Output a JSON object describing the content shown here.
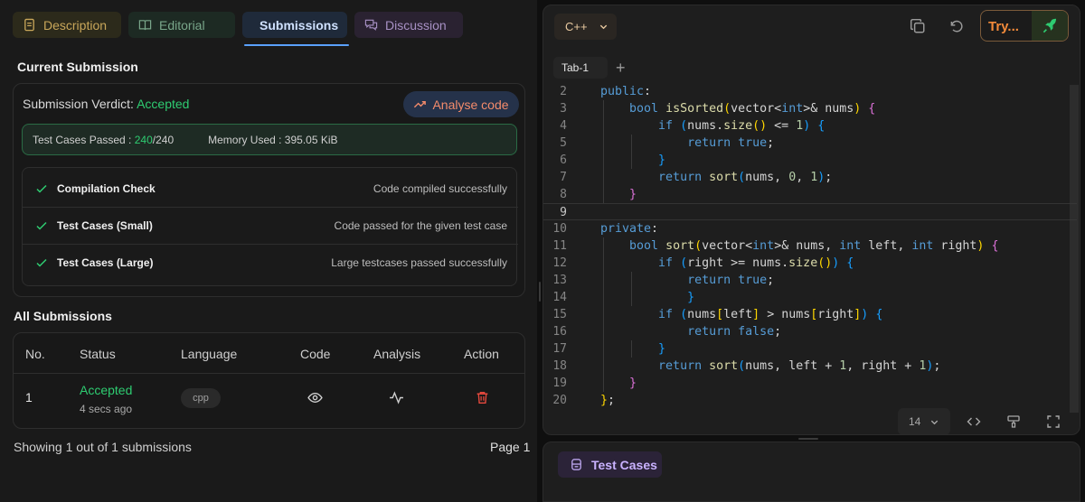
{
  "tabs": {
    "description": "Description",
    "editorial": "Editorial",
    "submissions": "Submissions",
    "discussion": "Discussion"
  },
  "current": {
    "heading": "Current Submission",
    "verdict_label": "Submission Verdict:",
    "verdict_value": "Accepted",
    "analyse_label": "Analyse code",
    "tests_label": "Test Cases Passed :",
    "tests_passed": "240",
    "tests_total": "/240",
    "memory_label": "Memory Used : 395.05 KiB",
    "checks": [
      {
        "name": "Compilation Check",
        "message": "Code compiled successfully"
      },
      {
        "name": "Test Cases (Small)",
        "message": "Code passed for the given test case"
      },
      {
        "name": "Test Cases (Large)",
        "message": "Large testcases passed successfully"
      }
    ]
  },
  "all": {
    "heading": "All Submissions",
    "columns": [
      "No.",
      "Status",
      "Language",
      "Code",
      "Analysis",
      "Action"
    ],
    "rows": [
      {
        "no": "1",
        "status": "Accepted",
        "time": "4 secs ago",
        "language": "cpp"
      }
    ],
    "footer_left": "Showing 1 out of 1 submissions",
    "footer_right": "Page 1"
  },
  "editor": {
    "language": "C++",
    "try_label": "Try...",
    "tab_label": "Tab-1",
    "font_size": "14",
    "line_numbers": [
      "2",
      "3",
      "4",
      "5",
      "6",
      "7",
      "8",
      "9",
      "10",
      "11",
      "12",
      "13",
      "14",
      "15",
      "16",
      "17",
      "18",
      "19",
      "20"
    ]
  },
  "testcases": {
    "label": "Test Cases"
  },
  "colors": {
    "accent_blue": "#5aa1ff",
    "success": "#2ecc71",
    "danger": "#e5483d",
    "orange": "#f28a3a"
  }
}
